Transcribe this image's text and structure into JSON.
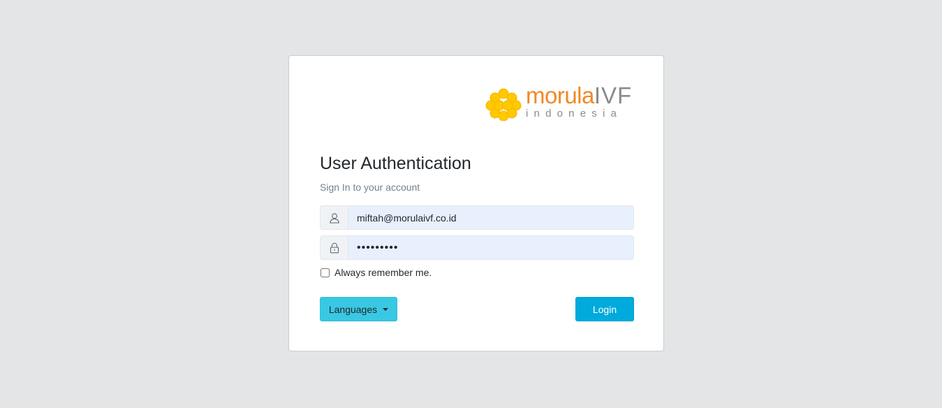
{
  "brand": {
    "name_part1": "morula",
    "name_part2": "IVF",
    "tagline": "indonesia",
    "flower_color": "#ffc800",
    "name_color": "#f08a24",
    "sub_color": "#8a8a8a"
  },
  "auth": {
    "title": "User Authentication",
    "subtitle": "Sign In to your account",
    "username_value": "miftah@morulaivf.co.id",
    "password_value": "•••••••••",
    "remember_label": "Always remember me.",
    "languages_label": "Languages",
    "login_label": "Login"
  },
  "icons": {
    "username": "user-icon",
    "password": "lock-icon",
    "languages": "caret-down-icon"
  },
  "colors": {
    "page_bg": "#e4e5e6",
    "languages_btn": "#39c8e3",
    "login_btn": "#00aadb",
    "input_bg": "#e8f0fe"
  }
}
